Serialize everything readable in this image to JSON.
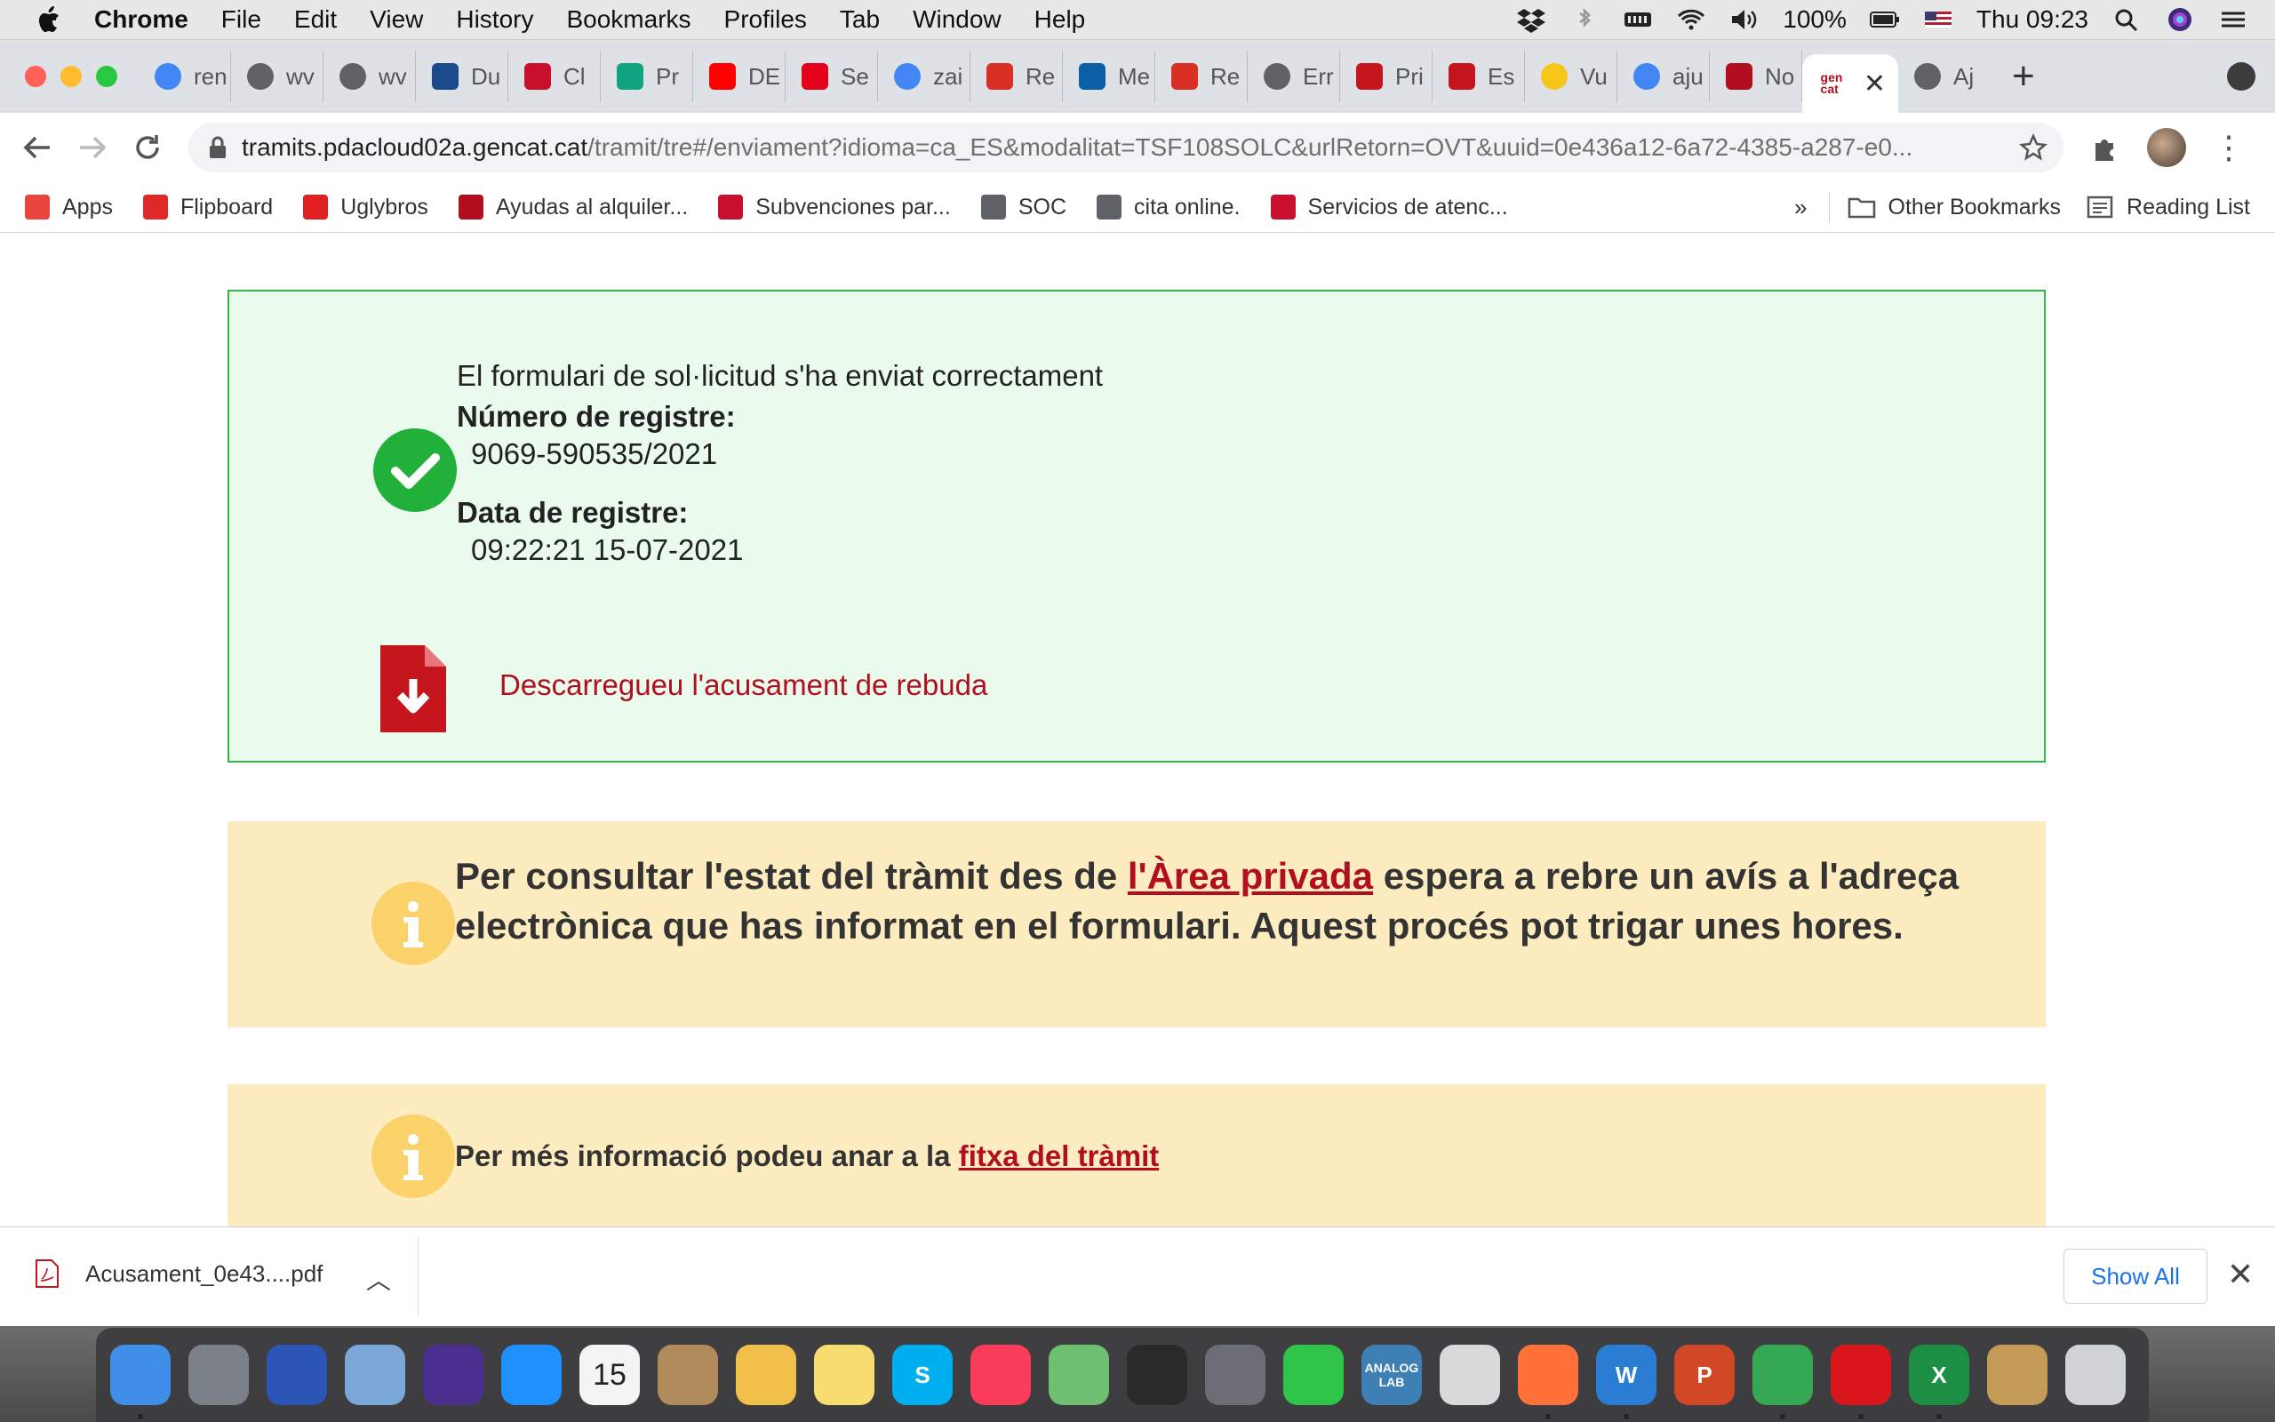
{
  "menubar": {
    "app_name": "Chrome",
    "items": [
      "File",
      "Edit",
      "View",
      "History",
      "Bookmarks",
      "Profiles",
      "Tab",
      "Window",
      "Help"
    ],
    "battery": "100%",
    "clock": "Thu 09:23"
  },
  "tabs": [
    {
      "title": "ren",
      "favicon": "google-icon",
      "color": "#4285f4"
    },
    {
      "title": "wv",
      "favicon": "globe-icon",
      "color": "#5f6368"
    },
    {
      "title": "wv",
      "favicon": "globe-icon",
      "color": "#5f6368"
    },
    {
      "title": "Du",
      "favicon": "dgt-icon",
      "color": "#1b4a8a"
    },
    {
      "title": "Cl",
      "favicon": "spain-gov-icon",
      "color": "#c8102e"
    },
    {
      "title": "Pr",
      "favicon": "check-circle-icon",
      "color": "#10a37f"
    },
    {
      "title": "DE",
      "favicon": "youtube-icon",
      "color": "#ff0000"
    },
    {
      "title": "Se",
      "favicon": "red-arrow-icon",
      "color": "#e2001a"
    },
    {
      "title": "zai",
      "favicon": "google-icon",
      "color": "#4285f4"
    },
    {
      "title": "Re",
      "favicon": "gmail-icon",
      "color": "#d93025"
    },
    {
      "title": "Me",
      "favicon": "blue-square-icon",
      "color": "#0b5fa5"
    },
    {
      "title": "Re",
      "favicon": "gmail-icon",
      "color": "#d93025"
    },
    {
      "title": "Err",
      "favicon": "globe-icon",
      "color": "#5f6368"
    },
    {
      "title": "Pri",
      "favicon": "red-square-icon",
      "color": "#c4161c"
    },
    {
      "title": "Es",
      "favicon": "red-square-icon",
      "color": "#c4161c"
    },
    {
      "title": "Vu",
      "favicon": "yellow-dot-icon",
      "color": "#f5c518"
    },
    {
      "title": "aju",
      "favicon": "google-icon",
      "color": "#4285f4"
    },
    {
      "title": "No",
      "favicon": "gencat-icon",
      "color": "#b10f1f"
    }
  ],
  "active_tab": {
    "favicon": "gencat-icon",
    "color": "#b10f1f"
  },
  "last_tab": {
    "title": "Aj",
    "favicon": "globe-icon",
    "color": "#5f6368"
  },
  "address": {
    "host": "tramits.pdacloud02a.gencat.cat",
    "path": "/tramit/tre#/enviament?idioma=ca_ES&modalitat=TSF108SOLC&urlRetorn=OVT&uuid=0e436a12-6a72-4385-a287-e0..."
  },
  "bookmarks": [
    {
      "label": "Apps",
      "color": "#e8453c"
    },
    {
      "label": "Flipboard",
      "color": "#e12828"
    },
    {
      "label": "Uglybros",
      "color": "#e02020"
    },
    {
      "label": "Ayudas al alquiler...",
      "color": "#b10f1f"
    },
    {
      "label": "Subvenciones par...",
      "color": "#c8102e"
    },
    {
      "label": "SOC",
      "color": "#5f6368"
    },
    {
      "label": "cita online.",
      "color": "#5f6368"
    },
    {
      "label": "Servicios de atenc...",
      "color": "#c8102e"
    }
  ],
  "bookmarks_more": "»",
  "other_bookmarks": "Other Bookmarks",
  "reading_list": "Reading List",
  "success": {
    "title": "El formulari de sol·licitud s'ha enviat correctament",
    "registration_number_label": "Número de registre:",
    "registration_number": "9069-590535/2021",
    "registration_date_label": "Data de registre:",
    "registration_date": "09:22:21 15-07-2021",
    "download_link": "Descarregueu l'acusament de rebuda"
  },
  "info1": {
    "before": "Per consultar l'estat del tràmit des de ",
    "link": "l'Àrea privada",
    "after": " espera a rebre un avís a l'adreça electrònica que has informat en el formulari. Aquest procés pot trigar unes hores."
  },
  "info2": {
    "before": "Per més informació podeu anar a la ",
    "link": "fitxa del tràmit"
  },
  "download_shelf": {
    "filename": "Acusament_0e43....pdf",
    "show_all": "Show All"
  },
  "colors": {
    "success_bg": "#eafaec",
    "success_border": "#36b44a",
    "check_green": "#21b03a",
    "link_red": "#b10f1f",
    "info_bg": "#fdecbf",
    "info_icon": "#fbd169"
  },
  "dock_apps": [
    {
      "name": "finder",
      "label": "",
      "color": "#3f8ee8",
      "running": true
    },
    {
      "name": "launchpad",
      "label": "",
      "color": "#7a7f88",
      "running": false
    },
    {
      "name": "dropbox",
      "label": "",
      "color": "#2b55b7",
      "running": false
    },
    {
      "name": "mail",
      "label": "",
      "color": "#7ba7d8",
      "running": false
    },
    {
      "name": "siri",
      "label": "",
      "color": "#4a2f8f",
      "running": false
    },
    {
      "name": "safari",
      "label": "",
      "color": "#1e90ff",
      "running": false
    },
    {
      "name": "calendar",
      "label": "15",
      "color": "#f4f4f4",
      "running": false
    },
    {
      "name": "contacts",
      "label": "",
      "color": "#b08a5a",
      "running": false
    },
    {
      "name": "photos",
      "label": "",
      "color": "#f0c04a",
      "running": false
    },
    {
      "name": "notes",
      "label": "",
      "color": "#f7dc6f",
      "running": false
    },
    {
      "name": "skype",
      "label": "S",
      "color": "#00aff0",
      "running": false
    },
    {
      "name": "music",
      "label": "",
      "color": "#fa3c5a",
      "running": false
    },
    {
      "name": "maps",
      "label": "",
      "color": "#6fbf73",
      "running": false
    },
    {
      "name": "logic",
      "label": "",
      "color": "#2a2a2a",
      "running": false
    },
    {
      "name": "system-preferences",
      "label": "",
      "color": "#6b6f75",
      "running": false
    },
    {
      "name": "facetime",
      "label": "",
      "color": "#2fc44a",
      "running": false
    },
    {
      "name": "analog-lab",
      "label": "ANALOG LAB",
      "color": "#3e7fb6",
      "running": false
    },
    {
      "name": "preview",
      "label": "",
      "color": "#d9d9d9",
      "running": false
    },
    {
      "name": "firefox",
      "label": "",
      "color": "#ff7139",
      "running": true
    },
    {
      "name": "word",
      "label": "W",
      "color": "#2b7cd3",
      "running": true
    },
    {
      "name": "powerpoint",
      "label": "P",
      "color": "#d24726",
      "running": false
    },
    {
      "name": "chrome",
      "label": "",
      "color": "#34a853",
      "running": true
    },
    {
      "name": "acrobat",
      "label": "",
      "color": "#d9161c",
      "running": true
    },
    {
      "name": "excel",
      "label": "X",
      "color": "#1d8f45",
      "running": true
    },
    {
      "name": "pencil",
      "label": "",
      "color": "#c49a57",
      "running": false
    },
    {
      "name": "trash",
      "label": "",
      "color": "#cfd3d8",
      "running": false
    }
  ]
}
